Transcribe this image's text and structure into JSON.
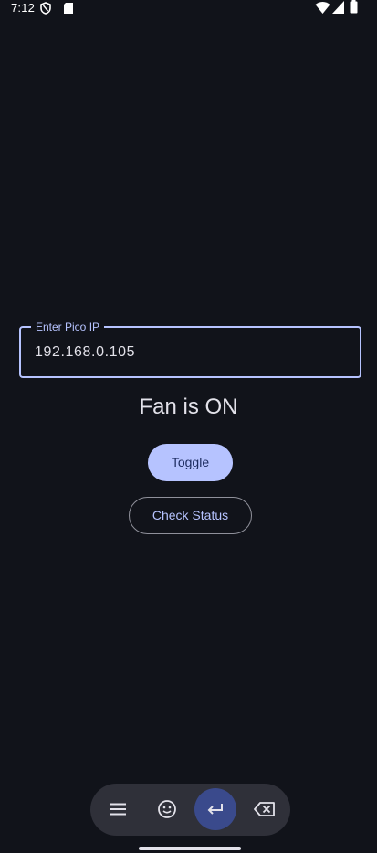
{
  "status_bar": {
    "time": "7:12",
    "left_icons": [
      "vpn-shield-icon",
      "sd-card-icon"
    ],
    "right_icons": [
      "wifi-icon",
      "cell-signal-icon",
      "battery-icon"
    ]
  },
  "ip_input": {
    "label": "Enter Pico IP",
    "value": "192.168.0.105"
  },
  "fan_status_text": "Fan is ON",
  "buttons": {
    "toggle": "Toggle",
    "check_status": "Check Status"
  },
  "keyboard_toolbar": {
    "items": [
      "menu-icon",
      "emoji-icon",
      "enter-icon",
      "backspace-icon"
    ]
  },
  "colors": {
    "background": "#11131a",
    "accent": "#b6c3ff",
    "on_accent": "#1d2c60",
    "text": "#e3e2ea",
    "outline": "#8f909a"
  }
}
